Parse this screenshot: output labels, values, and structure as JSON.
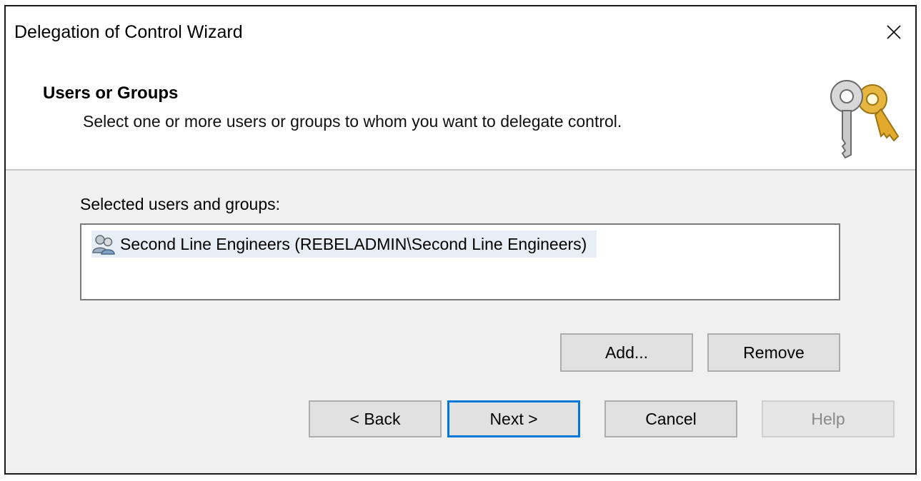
{
  "window": {
    "title": "Delegation of Control Wizard",
    "close_glyph": "✕"
  },
  "header": {
    "title": "Users or Groups",
    "subtitle": "Select one or more users or groups to whom you want to delegate control.",
    "icon": "keys-icon"
  },
  "selection": {
    "label": "Selected users and groups:",
    "items": [
      {
        "icon": "group-icon",
        "text": "Second Line Engineers (REBELADMIN\\Second Line Engineers)",
        "selected": true
      }
    ],
    "add_label": "Add...",
    "remove_label": "Remove"
  },
  "footer": {
    "back_label": "< Back",
    "next_label": "Next >",
    "cancel_label": "Cancel",
    "help_label": "Help",
    "help_enabled": false
  },
  "colors": {
    "accent": "#0078d7",
    "window_bg": "#f0f0f0",
    "header_bg": "#ffffff"
  }
}
